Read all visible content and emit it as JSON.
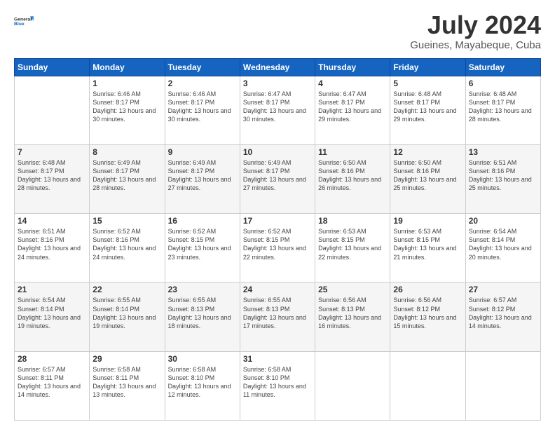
{
  "logo": {
    "line1": "General",
    "line2": "Blue"
  },
  "title": "July 2024",
  "subtitle": "Gueines, Mayabeque, Cuba",
  "weekdays": [
    "Sunday",
    "Monday",
    "Tuesday",
    "Wednesday",
    "Thursday",
    "Friday",
    "Saturday"
  ],
  "weeks": [
    [
      {
        "day": "",
        "info": ""
      },
      {
        "day": "1",
        "info": "Sunrise: 6:46 AM\nSunset: 8:17 PM\nDaylight: 13 hours\nand 30 minutes."
      },
      {
        "day": "2",
        "info": "Sunrise: 6:46 AM\nSunset: 8:17 PM\nDaylight: 13 hours\nand 30 minutes."
      },
      {
        "day": "3",
        "info": "Sunrise: 6:47 AM\nSunset: 8:17 PM\nDaylight: 13 hours\nand 30 minutes."
      },
      {
        "day": "4",
        "info": "Sunrise: 6:47 AM\nSunset: 8:17 PM\nDaylight: 13 hours\nand 29 minutes."
      },
      {
        "day": "5",
        "info": "Sunrise: 6:48 AM\nSunset: 8:17 PM\nDaylight: 13 hours\nand 29 minutes."
      },
      {
        "day": "6",
        "info": "Sunrise: 6:48 AM\nSunset: 8:17 PM\nDaylight: 13 hours\nand 28 minutes."
      }
    ],
    [
      {
        "day": "7",
        "info": ""
      },
      {
        "day": "8",
        "info": "Sunrise: 6:49 AM\nSunset: 8:17 PM\nDaylight: 13 hours\nand 28 minutes."
      },
      {
        "day": "9",
        "info": "Sunrise: 6:49 AM\nSunset: 8:17 PM\nDaylight: 13 hours\nand 27 minutes."
      },
      {
        "day": "10",
        "info": "Sunrise: 6:49 AM\nSunset: 8:17 PM\nDaylight: 13 hours\nand 27 minutes."
      },
      {
        "day": "11",
        "info": "Sunrise: 6:50 AM\nSunset: 8:16 PM\nDaylight: 13 hours\nand 26 minutes."
      },
      {
        "day": "12",
        "info": "Sunrise: 6:50 AM\nSunset: 8:16 PM\nDaylight: 13 hours\nand 25 minutes."
      },
      {
        "day": "13",
        "info": "Sunrise: 6:51 AM\nSunset: 8:16 PM\nDaylight: 13 hours\nand 25 minutes."
      }
    ],
    [
      {
        "day": "14",
        "info": ""
      },
      {
        "day": "15",
        "info": "Sunrise: 6:52 AM\nSunset: 8:16 PM\nDaylight: 13 hours\nand 24 minutes."
      },
      {
        "day": "16",
        "info": "Sunrise: 6:52 AM\nSunset: 8:15 PM\nDaylight: 13 hours\nand 23 minutes."
      },
      {
        "day": "17",
        "info": "Sunrise: 6:52 AM\nSunset: 8:15 PM\nDaylight: 13 hours\nand 22 minutes."
      },
      {
        "day": "18",
        "info": "Sunrise: 6:53 AM\nSunset: 8:15 PM\nDaylight: 13 hours\nand 22 minutes."
      },
      {
        "day": "19",
        "info": "Sunrise: 6:53 AM\nSunset: 8:15 PM\nDaylight: 13 hours\nand 21 minutes."
      },
      {
        "day": "20",
        "info": "Sunrise: 6:54 AM\nSunset: 8:14 PM\nDaylight: 13 hours\nand 20 minutes."
      }
    ],
    [
      {
        "day": "21",
        "info": ""
      },
      {
        "day": "22",
        "info": "Sunrise: 6:55 AM\nSunset: 8:14 PM\nDaylight: 13 hours\nand 19 minutes."
      },
      {
        "day": "23",
        "info": "Sunrise: 6:55 AM\nSunset: 8:13 PM\nDaylight: 13 hours\nand 18 minutes."
      },
      {
        "day": "24",
        "info": "Sunrise: 6:55 AM\nSunset: 8:13 PM\nDaylight: 13 hours\nand 17 minutes."
      },
      {
        "day": "25",
        "info": "Sunrise: 6:56 AM\nSunset: 8:13 PM\nDaylight: 13 hours\nand 16 minutes."
      },
      {
        "day": "26",
        "info": "Sunrise: 6:56 AM\nSunset: 8:12 PM\nDaylight: 13 hours\nand 15 minutes."
      },
      {
        "day": "27",
        "info": "Sunrise: 6:57 AM\nSunset: 8:12 PM\nDaylight: 13 hours\nand 14 minutes."
      }
    ],
    [
      {
        "day": "28",
        "info": "Sunrise: 6:57 AM\nSunset: 8:11 PM\nDaylight: 13 hours\nand 14 minutes."
      },
      {
        "day": "29",
        "info": "Sunrise: 6:58 AM\nSunset: 8:11 PM\nDaylight: 13 hours\nand 13 minutes."
      },
      {
        "day": "30",
        "info": "Sunrise: 6:58 AM\nSunset: 8:10 PM\nDaylight: 13 hours\nand 12 minutes."
      },
      {
        "day": "31",
        "info": "Sunrise: 6:58 AM\nSunset: 8:10 PM\nDaylight: 13 hours\nand 11 minutes."
      },
      {
        "day": "",
        "info": ""
      },
      {
        "day": "",
        "info": ""
      },
      {
        "day": "",
        "info": ""
      }
    ]
  ],
  "week1_day7_info": "Sunrise: 6:48 AM\nSunset: 8:17 PM\nDaylight: 13 hours\nand 28 minutes.",
  "week2_day7_info": "Sunrise: 6:51 AM\nSunset: 8:16 PM\nDaylight: 13 hours\nand 25 minutes.",
  "week3_day14_info": "Sunrise: 6:51 AM\nSunset: 8:16 PM\nDaylight: 13 hours\nand 24 minutes.",
  "week4_day21_info": "Sunrise: 6:54 AM\nSunset: 8:14 PM\nDaylight: 13 hours\nand 19 minutes."
}
